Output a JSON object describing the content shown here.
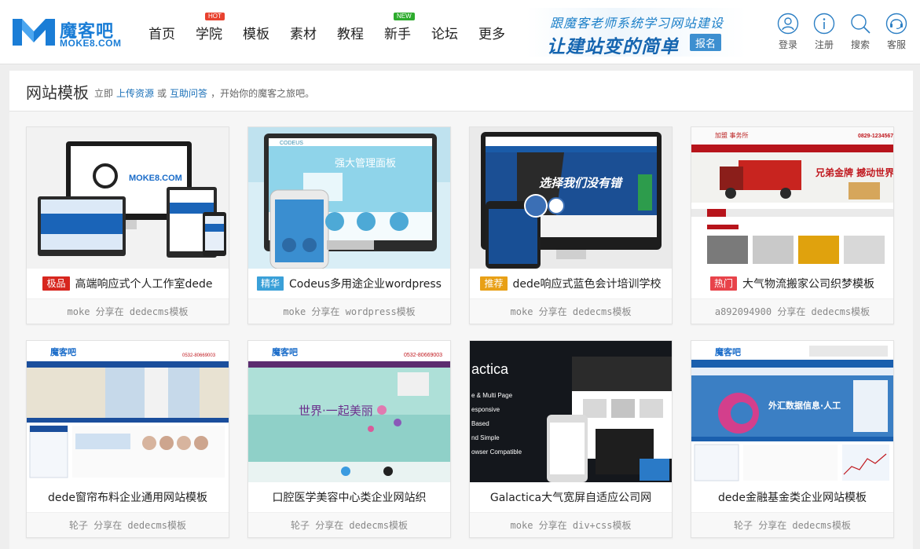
{
  "logo": {
    "cn": "魔客吧",
    "en": "MOKE8.COM"
  },
  "nav": [
    {
      "label": "首页",
      "badge": ""
    },
    {
      "label": "学院",
      "badge": "HOT"
    },
    {
      "label": "模板",
      "badge": ""
    },
    {
      "label": "素材",
      "badge": ""
    },
    {
      "label": "教程",
      "badge": ""
    },
    {
      "label": "新手",
      "badge": "NEW"
    },
    {
      "label": "论坛",
      "badge": ""
    },
    {
      "label": "更多",
      "badge": ""
    }
  ],
  "promo": {
    "top": "跟魔客老师系统学习网站建设",
    "bottom": "让建站变的简单",
    "button": "报名"
  },
  "tools": [
    {
      "label": "登录",
      "icon": "user-icon"
    },
    {
      "label": "注册",
      "icon": "info-icon"
    },
    {
      "label": "搜索",
      "icon": "search-icon"
    },
    {
      "label": "客服",
      "icon": "headset-icon"
    }
  ],
  "panel": {
    "title": "网站模板",
    "sub_prefix": "立即",
    "link_upload": "上传资源",
    "sub_or": "或",
    "link_qa": "互助问答",
    "sub_suffix": "，开始你的魔客之旅吧。"
  },
  "cards": [
    {
      "tag": "极品",
      "tag_color": "#d7261e",
      "title": "高端响应式个人工作室dede",
      "meta": "moke 分享在 dedecms模板"
    },
    {
      "tag": "精华",
      "tag_color": "#3aa0d8",
      "title": "Codeus多用途企业wordpress",
      "meta": "moke 分享在 wordpress模板"
    },
    {
      "tag": "推荐",
      "tag_color": "#e8a016",
      "title": "dede响应式蓝色会计培训学校",
      "meta": "moke 分享在 dedecms模板"
    },
    {
      "tag": "热门",
      "tag_color": "#e8434a",
      "title": "大气物流搬家公司织梦模板",
      "meta": "a892094900 分享在 dedecms模板"
    },
    {
      "tag": "",
      "tag_color": "",
      "title": "dede窗帘布料企业通用网站模板",
      "meta": "轮子 分享在 dedecms模板"
    },
    {
      "tag": "",
      "tag_color": "",
      "title": "口腔医学美容中心类企业网站织",
      "meta": "轮子 分享在 dedecms模板"
    },
    {
      "tag": "",
      "tag_color": "",
      "title": "Galactica大气宽屏自适应公司网",
      "meta": "moke 分享在 div+css模板"
    },
    {
      "tag": "",
      "tag_color": "",
      "title": "dede金融基金类企业网站模板",
      "meta": "轮子 分享在 dedecms模板"
    }
  ],
  "thumb_text": {
    "t1_brand": "MOKE8.COM",
    "t2_brand": "CODEUS",
    "t2_heading": "强大管理面板",
    "t3_slogan": "选择我们没有错",
    "t4_phone": "0829-1234567",
    "t4_banner": "兄弟金牌 撼动世界",
    "t5_brand": "魔客吧",
    "t5_phone": "0532-80669003",
    "t6_brand": "魔客吧",
    "t6_phone": "0532-80669003",
    "t6_slogan": "世界·一起美丽",
    "t7_brand": "actica",
    "t7_lines": [
      "e & Multi Page",
      "esponsive",
      "Based",
      "nd Simple",
      "owser Compatible"
    ],
    "t8_brand": "魔客吧",
    "t8_banner": "外汇数据信息·人工"
  },
  "colors": {
    "brand": "#1a7dd6",
    "link": "#1a70b8",
    "hot": "#e8422f",
    "new": "#2dab2d"
  }
}
